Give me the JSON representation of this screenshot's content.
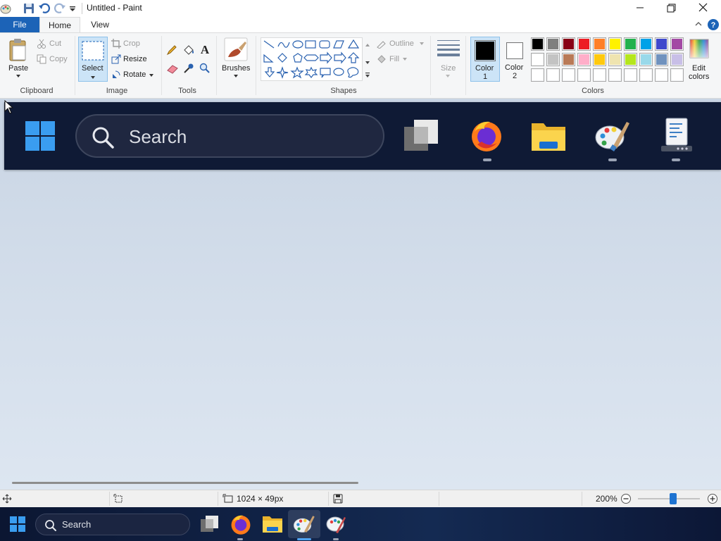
{
  "titlebar": {
    "title": "Untitled - Paint",
    "quick_access": [
      "paint-app-icon",
      "save-icon",
      "undo-icon",
      "redo-icon",
      "customize-quick-access-icon"
    ],
    "window_controls": [
      "minimize-icon",
      "maximize-icon",
      "close-icon"
    ]
  },
  "tabs": [
    {
      "label": "File",
      "active": false
    },
    {
      "label": "Home",
      "active": true
    },
    {
      "label": "View",
      "active": false
    }
  ],
  "ribbon": {
    "clipboard": {
      "group_label": "Clipboard",
      "paste": "Paste",
      "cut": "Cut",
      "copy": "Copy"
    },
    "image": {
      "group_label": "Image",
      "select": "Select",
      "crop": "Crop",
      "resize": "Resize",
      "rotate": "Rotate"
    },
    "tools": {
      "group_label": "Tools",
      "items": [
        "pencil-icon",
        "fill-icon",
        "text-icon",
        "eraser-icon",
        "color-picker-icon",
        "magnifier-icon"
      ]
    },
    "brushes": {
      "label": "Brushes"
    },
    "shapes": {
      "group_label": "Shapes",
      "outline": "Outline",
      "fill": "Fill"
    },
    "size": {
      "label": "Size"
    },
    "colors": {
      "group_label": "Colors",
      "color1_label": "Color",
      "color1_num": "1",
      "color2_label": "Color",
      "color2_num": "2",
      "color1_value": "#000000",
      "color2_value": "#ffffff",
      "edit_label": "Edit",
      "edit_label2": "colors",
      "palette_row1": [
        "#000000",
        "#7f7f7f",
        "#880015",
        "#ed1c24",
        "#ff7f27",
        "#fff200",
        "#22b14c",
        "#00a2e8",
        "#3f48cc",
        "#a349a4"
      ],
      "palette_row2": [
        "#ffffff",
        "#c3c3c3",
        "#b97a57",
        "#ffaec9",
        "#ffc90e",
        "#efe4b0",
        "#b5e61d",
        "#99d9ea",
        "#7092be",
        "#c8bfe7"
      ],
      "palette_row3_empty": 10
    }
  },
  "canvas": {
    "image_content": "taskbar-screenshot",
    "search_text": "Search",
    "icons": [
      "windows-start-icon",
      "search-icon",
      "task-view-icon",
      "firefox-icon",
      "file-explorer-icon",
      "paint-icon",
      "notepad-icon"
    ]
  },
  "statusbar": {
    "dimensions": "1024 × 49px",
    "zoom": "200%"
  },
  "taskbar": {
    "search_text": "Search",
    "apps": [
      "task-view-icon",
      "firefox-icon",
      "file-explorer-icon",
      "paint-icon",
      "paint-old-icon"
    ]
  },
  "accent_colors": {
    "file_tab": "#1c63b7",
    "selection": "#cce4f7",
    "zoom_thumb": "#1e73d1"
  }
}
